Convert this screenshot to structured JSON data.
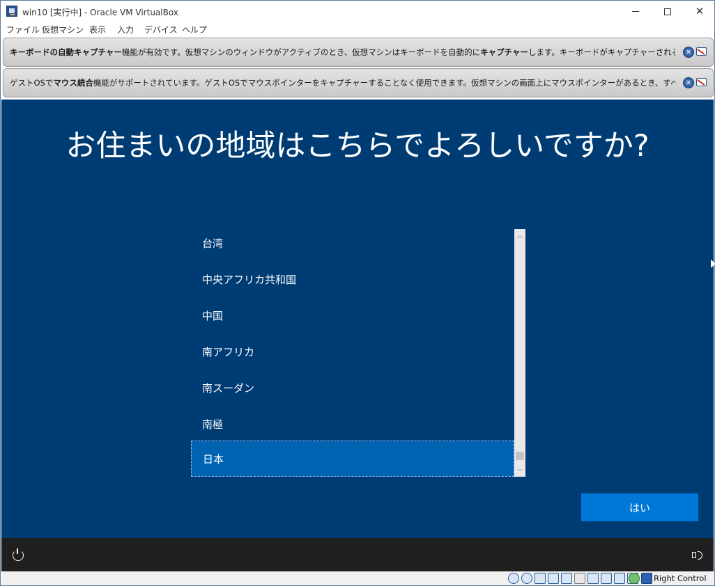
{
  "window": {
    "title": "win10 [実行中] - Oracle VM VirtualBox",
    "min_icon": "minimize-icon",
    "max_icon": "maximize-icon",
    "close_glyph": "✕"
  },
  "menu": {
    "items": [
      "ファイル",
      "仮想マシン",
      "表示",
      "入力",
      "デバイス",
      "ヘルプ"
    ]
  },
  "banners": {
    "keyboard": {
      "bold_1": "キーボードの自動キャプチャー",
      "text_1": "機能が有効です。仮想マシンのウィンドウがアクティブのとき、仮想マシンはキーボードを自動的に",
      "bold_2": "キャプチャー",
      "text_2": "します。キーボードがキャプチャーされると、すべてのキーストローク"
    },
    "mouse": {
      "text_1": "ゲストOSで",
      "bold_1": "マウス統合",
      "text_2": "機能がサポートされています。ゲストOSでマウスポインターをキャプチャーすることなく使用できます。仮想マシンの画面上にマウスポインターがあるとき、すべてのマウスの動作は直接ゲスト"
    },
    "close_glyph": "✕"
  },
  "guest": {
    "heading": "お住まいの地域はこちらでよろしいですか?",
    "regions": [
      {
        "label": "台湾",
        "selected": false
      },
      {
        "label": "中央アフリカ共和国",
        "selected": false
      },
      {
        "label": "中国",
        "selected": false
      },
      {
        "label": "南アフリカ",
        "selected": false
      },
      {
        "label": "南スーダン",
        "selected": false
      },
      {
        "label": "南極",
        "selected": false
      },
      {
        "label": "日本",
        "selected": true
      }
    ],
    "scroll_up_glyph": "︿",
    "scroll_down_glyph": "﹀",
    "yes_label": "はい"
  },
  "statusbar": {
    "host_key": "Right Control"
  },
  "colors": {
    "guest_background": "#003c74",
    "selected_item": "#0063b1",
    "primary_button": "#0078d7"
  }
}
